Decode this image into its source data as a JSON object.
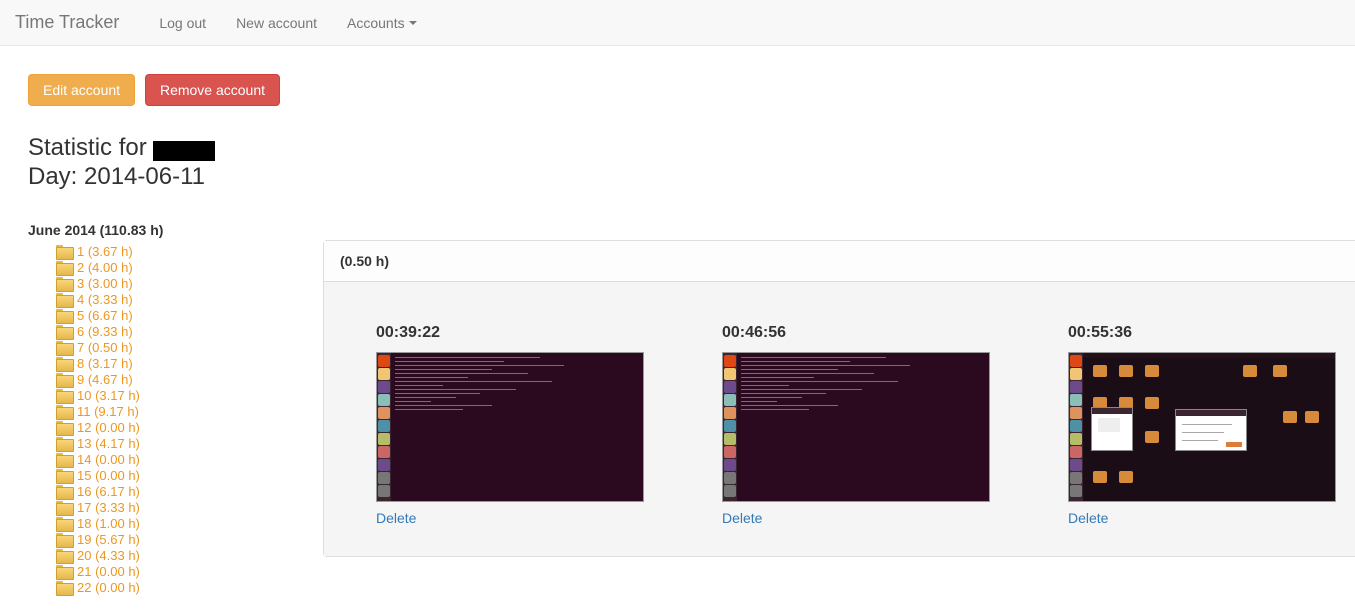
{
  "nav": {
    "brand": "Time Tracker",
    "items": [
      "Log out",
      "New account",
      "Accounts"
    ]
  },
  "buttons": {
    "edit": "Edit account",
    "remove": "Remove account"
  },
  "heading": {
    "prefix": "Statistic for ",
    "day_label": "Day: ",
    "day_value": "2014-06-11"
  },
  "month": {
    "title": "June 2014 (110.83 h)",
    "days": [
      "1 (3.67 h)",
      "2 (4.00 h)",
      "3 (3.00 h)",
      "4 (3.33 h)",
      "5 (6.67 h)",
      "6 (9.33 h)",
      "7 (0.50 h)",
      "8 (3.17 h)",
      "9 (4.67 h)",
      "10 (3.17 h)",
      "11 (9.17 h)",
      "12 (0.00 h)",
      "13 (4.17 h)",
      "14 (0.00 h)",
      "15 (0.00 h)",
      "16 (6.17 h)",
      "17 (3.33 h)",
      "18 (1.00 h)",
      "19 (5.67 h)",
      "20 (4.33 h)",
      "21 (0.00 h)",
      "22 (0.00 h)"
    ]
  },
  "panel": {
    "title": "(0.50 h)",
    "delete_label": "Delete",
    "shots": [
      {
        "time": "00:39:22",
        "kind": "terminal"
      },
      {
        "time": "00:46:56",
        "kind": "terminal"
      },
      {
        "time": "00:55:36",
        "kind": "desktop"
      }
    ]
  }
}
